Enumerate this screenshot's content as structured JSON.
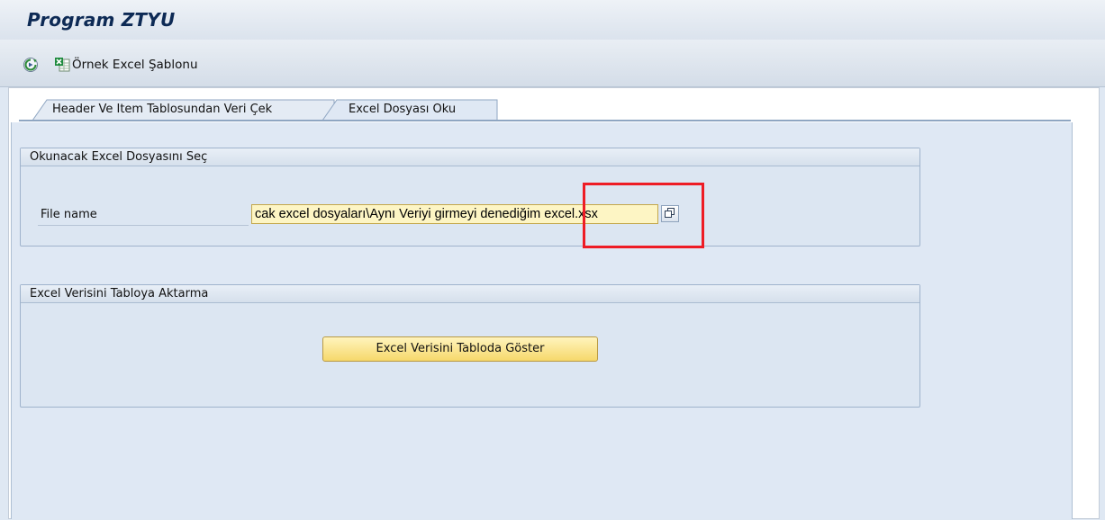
{
  "window": {
    "title": "Program ZTYU"
  },
  "toolbar": {
    "execute_icon": "execute-icon",
    "excel_icon": "excel-template-icon",
    "template_label": "Örnek Excel Şablonu"
  },
  "tabs": [
    {
      "label": "Header Ve Item Tablosundan Veri Çek",
      "active": false
    },
    {
      "label": "Excel Dosyası Oku",
      "active": true
    }
  ],
  "group_file": {
    "title": "Okunacak Excel Dosyasını Seç",
    "file_label": "File name",
    "file_value": "cak excel dosyaları\\Aynı Veriyi girmeyi denediğim excel.xsx",
    "f4_icon": "value-help-icon"
  },
  "group_transfer": {
    "title": "Excel Verisini Tabloya Aktarma",
    "button_label": "Excel Verisini Tabloda Göster"
  },
  "colors": {
    "highlight": "#ee1c25",
    "title": "#0d2a55",
    "button": "#f6d86b",
    "input_bg": "#fdf5c4"
  }
}
